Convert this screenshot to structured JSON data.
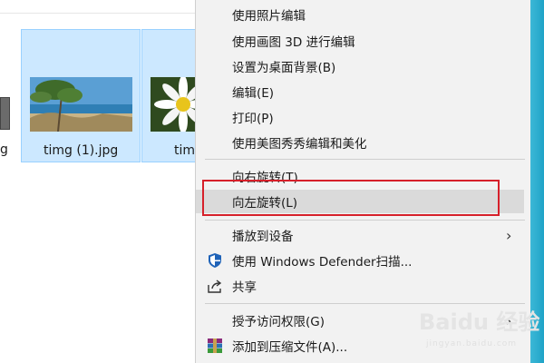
{
  "explorer": {
    "files": [
      {
        "name": "timg (1).jpg"
      },
      {
        "name": "tim"
      }
    ],
    "partial_left_label": "g"
  },
  "menu": {
    "items": [
      {
        "label": "使用照片编辑"
      },
      {
        "label": "使用画图 3D 进行编辑"
      },
      {
        "label": "设置为桌面背景(B)"
      },
      {
        "label": "编辑(E)"
      },
      {
        "label": "打印(P)"
      },
      {
        "label": "使用美图秀秀编辑和美化"
      },
      {
        "label": "向右旋转(T)"
      },
      {
        "label": "向左旋转(L)"
      },
      {
        "label": "播放到设备"
      },
      {
        "label": "使用 Windows Defender扫描..."
      },
      {
        "label": "共享"
      },
      {
        "label": "授予访问权限(G)"
      },
      {
        "label": "添加到压缩文件(A)..."
      }
    ]
  },
  "watermark": {
    "text": "Baidu 经验",
    "url": "jingyan.baidu.com"
  },
  "colors": {
    "selection": "#cce8ff",
    "highlight_box": "#d6202a",
    "menu_bg": "#f2f2f2"
  }
}
